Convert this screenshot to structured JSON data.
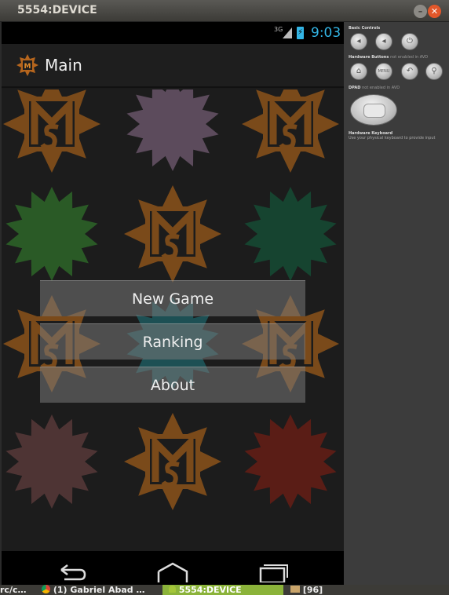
{
  "window": {
    "title": "5554:DEVICE",
    "minimize_glyph": "–",
    "close_glyph": "✕"
  },
  "status_bar": {
    "network": "3G",
    "time": "9:03",
    "battery_glyph": "⚡"
  },
  "action_bar": {
    "title": "Main",
    "icon": "app-logo-icon"
  },
  "menu": {
    "new_game": "New Game",
    "ranking": "Ranking",
    "about": "About"
  },
  "tiles": [
    {
      "kind": "logo",
      "color": "#7a4a1a"
    },
    {
      "kind": "star",
      "color": "#5c4b5c"
    },
    {
      "kind": "logo",
      "color": "#7a4a1a"
    },
    {
      "kind": "star",
      "color": "#2a5a26"
    },
    {
      "kind": "logo",
      "color": "#7a4a1a"
    },
    {
      "kind": "star",
      "color": "#164430"
    },
    {
      "kind": "logo",
      "color": "#7a4a1a"
    },
    {
      "kind": "star",
      "color": "#1d5054"
    },
    {
      "kind": "logo",
      "color": "#7a4a1a"
    },
    {
      "kind": "star",
      "color": "#4e3434"
    },
    {
      "kind": "logo",
      "color": "#7a4a1a"
    },
    {
      "kind": "star",
      "color": "#5a1d16"
    }
  ],
  "nav_bar": {
    "back_icon": "back-icon",
    "home_icon": "home-icon",
    "recents_icon": "recents-icon"
  },
  "controls_panel": {
    "basic_controls_label": "Basic Controls",
    "hardware_buttons_label": "Hardware Buttons",
    "hardware_buttons_note": "not enabled in AVD",
    "dpad_label": "DPAD",
    "dpad_note": "not enabled in AVD",
    "keyboard_label": "Hardware Keyboard",
    "keyboard_note": "Use your physical keyboard to provide input",
    "menu_button_label": "MENU"
  },
  "taskbar": {
    "items": [
      {
        "label": "rc/c…",
        "active": false
      },
      {
        "label": "(1) Gabriel Abad …",
        "active": false
      },
      {
        "label": "5554:DEVICE",
        "active": true
      },
      {
        "label": "[96]",
        "active": false
      }
    ]
  },
  "colors": {
    "accent": "#33b5e5",
    "logo_orange": "#7a4a1a",
    "active_task": "#8bb33a"
  }
}
